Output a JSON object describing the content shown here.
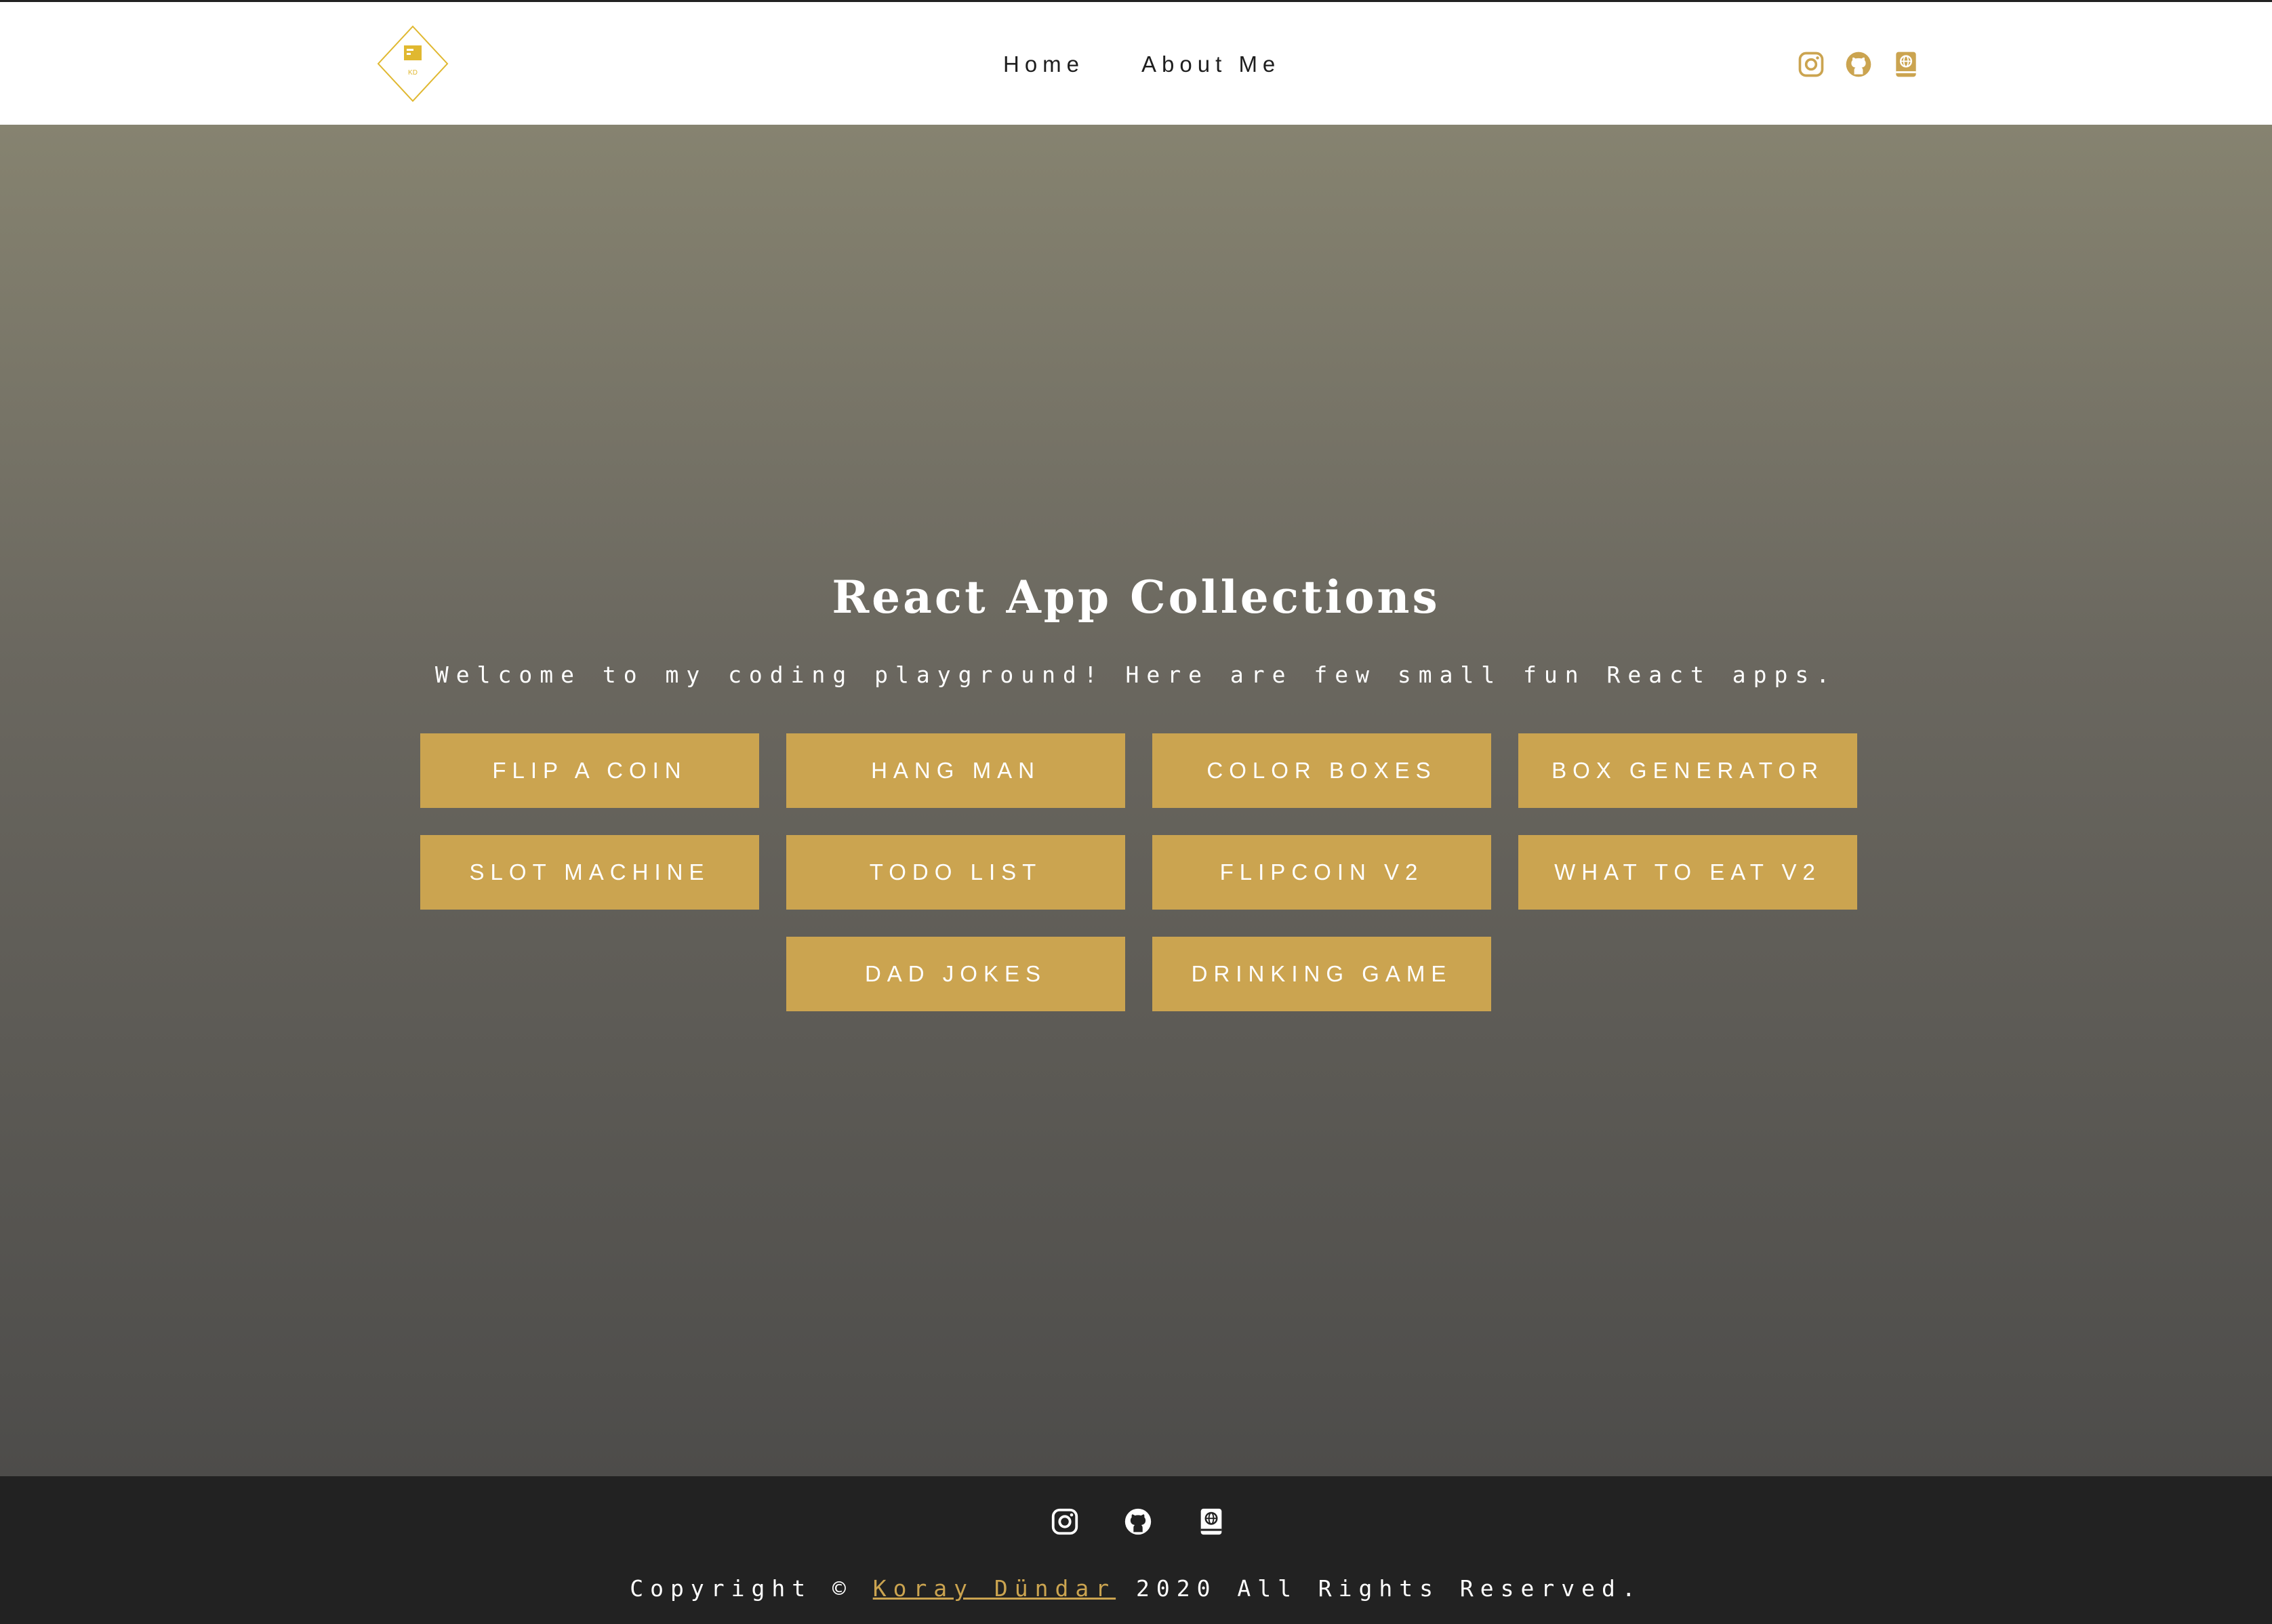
{
  "navbar": {
    "logo_initials": "KD",
    "links": [
      "Home",
      "About Me"
    ],
    "icons": [
      "instagram-icon",
      "github-icon",
      "book-globe-icon"
    ]
  },
  "hero": {
    "title": "React App Collections",
    "subtitle": "Welcome to my coding playground! Here are few small fun React apps.",
    "apps": [
      "FLIP A COIN",
      "HANG MAN",
      "COLOR BOXES",
      "BOX GENERATOR",
      "SLOT MACHINE",
      "TODO LIST",
      "FLIPCOIN V2",
      "WHAT TO EAT V2",
      "DAD JOKES",
      "DRINKING GAME"
    ]
  },
  "footer": {
    "icons": [
      "instagram-icon",
      "github-icon",
      "book-globe-icon"
    ],
    "copyright_prefix": "Copyright ©",
    "author": "Koray Dündar",
    "copyright_suffix": "2020 All Rights Reserved."
  },
  "colors": {
    "accent": "#cba450",
    "hero_top": "#868370",
    "hero_bottom": "#4d4c4a",
    "footer_bg": "#222222",
    "text_dark": "#1e1e1e"
  }
}
